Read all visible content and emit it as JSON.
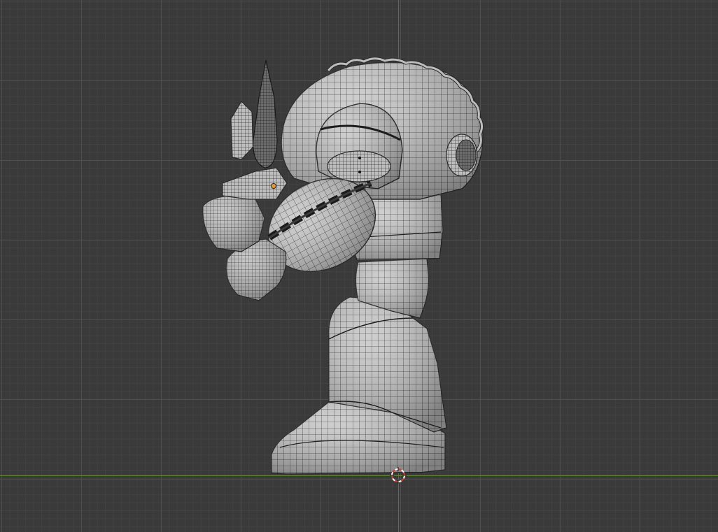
{
  "viewport": {
    "view": "side-orthographic",
    "shading": "solid-with-wireframe",
    "background_color": "#3a3a3a",
    "grid": true
  },
  "axes": {
    "z_axis_color": "#3c6aa8",
    "y_axis_color": "#5f8a2e"
  },
  "model": {
    "subject": "robot-character-mesh",
    "surface_color": "#c9c9c9",
    "wire_color": "#2a2a2a"
  },
  "colors": {
    "cursor_red": "#d83a3a",
    "cursor_white": "#ffffff",
    "origin_orange": "#e59a2c"
  }
}
